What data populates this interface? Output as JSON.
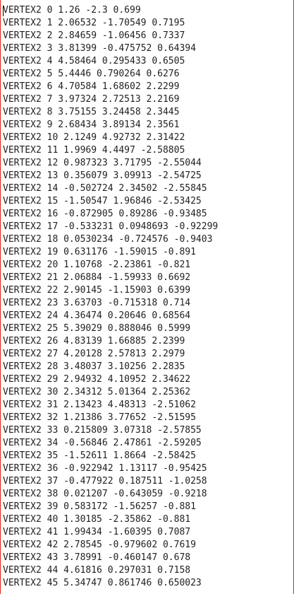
{
  "editor": {
    "lines": [
      "VERTEX2 0 1.26 -2.3 0.699",
      "VERTEX2 1 2.06532 -1.70549 0.7195",
      "VERTEX2 2 2.84659 -1.06456 0.7337",
      "VERTEX2 3 3.81399 -0.475752 0.64394",
      "VERTEX2 4 4.58464 0.295433 0.6505",
      "VERTEX2 5 5.4446 0.790264 0.6276",
      "VERTEX2 6 4.70584 1.68602 2.2299",
      "VERTEX2 7 3.97324 2.72513 2.2169",
      "VERTEX2 8 3.75155 3.24458 2.3445",
      "VERTEX2 9 2.68434 3.89134 2.3561",
      "VERTEX2 10 2.1249 4.92732 2.31422",
      "VERTEX2 11 1.9969 4.4497 -2.58805",
      "VERTEX2 12 0.987323 3.71795 -2.55044",
      "VERTEX2 13 0.356079 3.09913 -2.54725",
      "VERTEX2 14 -0.502724 2.34502 -2.55845",
      "VERTEX2 15 -1.50547 1.96846 -2.53425",
      "VERTEX2 16 -0.872905 0.89286 -0.93485",
      "VERTEX2 17 -0.533231 0.0948693 -0.92299",
      "VERTEX2 18 0.0530234 -0.724576 -0.9403",
      "VERTEX2 19 0.631176 -1.59015 -0.891",
      "VERTEX2 20 1.10768 -2.23861 -0.821",
      "VERTEX2 21 2.06884 -1.59933 0.6692",
      "VERTEX2 22 2.90145 -1.15903 0.6399",
      "VERTEX2 23 3.63703 -0.715318 0.714",
      "VERTEX2 24 4.36474 0.20646 0.68564",
      "VERTEX2 25 5.39029 0.888046 0.5999",
      "VERTEX2 26 4.83139 1.66885 2.2399",
      "VERTEX2 27 4.20128 2.57813 2.2979",
      "VERTEX2 28 3.48037 3.10256 2.2835",
      "VERTEX2 29 2.94932 4.10952 2.34622",
      "VERTEX2 30 2.34312 5.01364 2.25362",
      "VERTEX2 31 2.13423 4.48313 -2.51062",
      "VERTEX2 32 1.21386 3.77652 -2.51595",
      "VERTEX2 33 0.215809 3.07318 -2.57855",
      "VERTEX2 34 -0.56846 2.47861 -2.59205",
      "VERTEX2 35 -1.52611 1.8664 -2.58425",
      "VERTEX2 36 -0.922942 1.13117 -0.95425",
      "VERTEX2 37 -0.477922 0.187511 -1.0258",
      "VERTEX2 38 0.021207 -0.643059 -0.9218",
      "VERTEX2 39 0.583172 -1.56257 -0.881",
      "VERTEX2 40 1.30185 -2.35862 -0.881",
      "VERTEX2 41 1.99434 -1.60395 0.7087",
      "VERTEX2 42 2.78545 -0.979602 0.7619",
      "VERTEX2 43 3.78991 -0.460147 0.678",
      "VERTEX2 44 4.61816 0.297031 0.7158",
      "VERTEX2 45 5.34747 0.861746 0.650023"
    ]
  },
  "colors": {
    "border": "#e2231a",
    "text": "#1f1f1f",
    "background": "#ffffff"
  }
}
